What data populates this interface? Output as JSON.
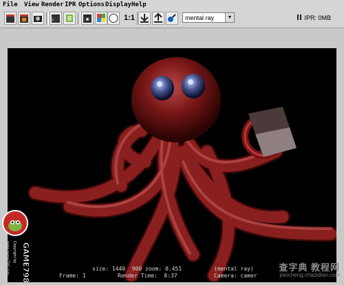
{
  "menu": [
    "File",
    "View",
    "Render",
    "IPR",
    "Options",
    "Display",
    "Help"
  ],
  "toolbar": {
    "one_to_one_label": "1:1",
    "renderer_selected": "mental ray",
    "ipr_status": "IPR: 0MB"
  },
  "hud": {
    "size_line": "size: 1440  900 zoom: 0.451",
    "renderer": "(mental ray)",
    "frame_line": "Frame: 1",
    "render_time_line": "Render Time:  8:37",
    "camera_line": "Camera: camer"
  },
  "watermark": {
    "logo_text": "GAME798",
    "copyright": "Copyright by",
    "site": "www.game798.com",
    "brand": "查字典 教程网",
    "domain": "jiaocheng.chazidian.com"
  },
  "colors": {
    "octopus": "#8a1f1f",
    "viewport": "#000000",
    "chrome": "#d4d4d4"
  }
}
